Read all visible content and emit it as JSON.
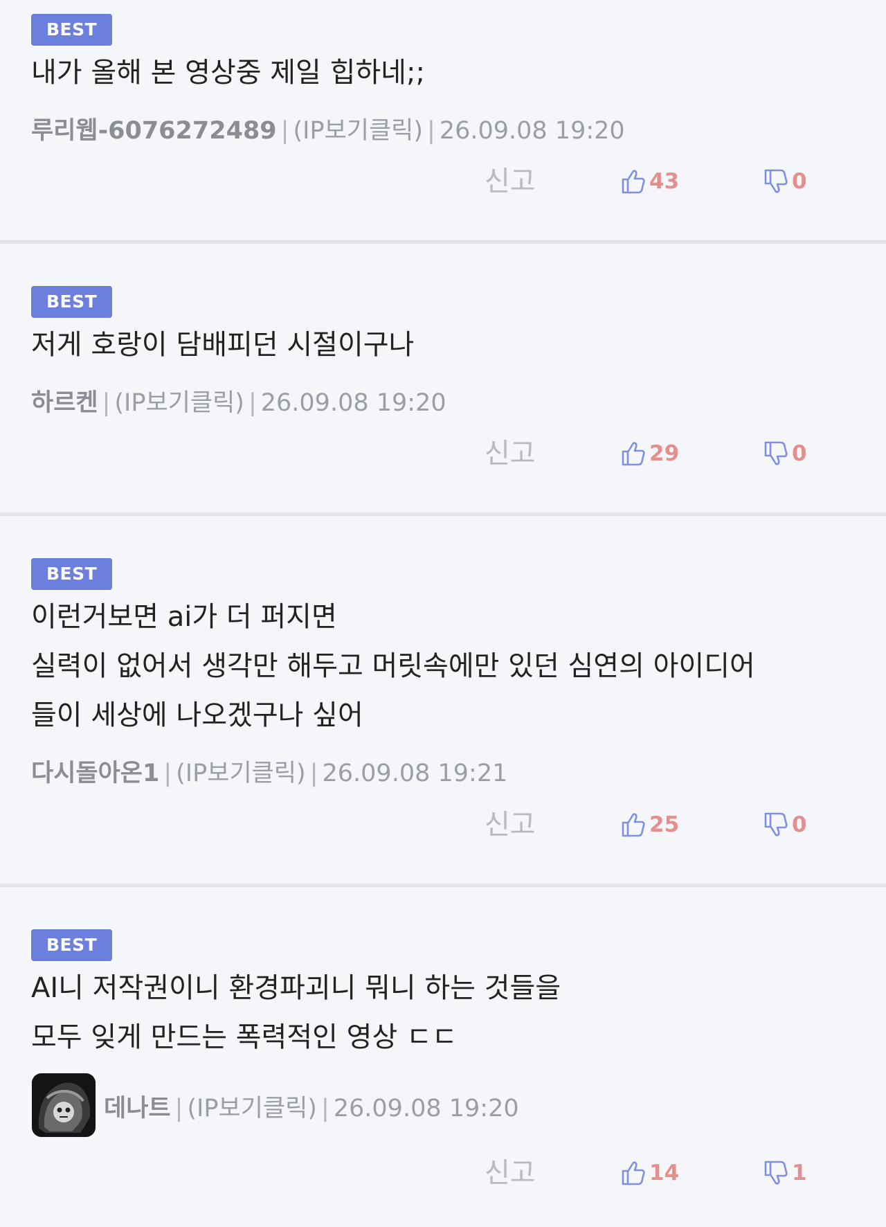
{
  "comments": [
    {
      "badge": "BEST",
      "lines": [
        "내가 올해 본 영상중 제일 힙하네;;"
      ],
      "nickname": "루리웹-6076272489",
      "ip": "(IP보기클릭)",
      "datetime": "26.09.08 19:20",
      "report": "신고",
      "likes": "43",
      "dislikes": "0"
    },
    {
      "badge": "BEST",
      "lines": [
        "저게 호랑이 담배피던 시절이구나"
      ],
      "nickname": "하르켄",
      "ip": "(IP보기클릭)",
      "datetime": "26.09.08 19:20",
      "report": "신고",
      "likes": "29",
      "dislikes": "0"
    },
    {
      "badge": "BEST",
      "lines": [
        "이런거보면 ai가 더 퍼지면",
        "실력이 없어서 생각만 해두고 머릿속에만 있던 심연의 아이디어",
        "들이 세상에 나오겠구나 싶어"
      ],
      "nickname": "다시돌아온1",
      "ip": "(IP보기클릭)",
      "datetime": "26.09.08 19:21",
      "report": "신고",
      "likes": "25",
      "dislikes": "0"
    },
    {
      "badge": "BEST",
      "lines": [
        "AI니 저작권이니 환경파괴니 뭐니 하는 것들을",
        "모두 잊게 만드는 폭력적인 영상 ㄷㄷ"
      ],
      "nickname": "데나트",
      "ip": "(IP보기클릭)",
      "datetime": "26.09.08 19:20",
      "report": "신고",
      "likes": "14",
      "dislikes": "1"
    }
  ],
  "colors": {
    "badge": "#6d7fdc",
    "background": "#f5f6fa",
    "count": "#e48e8e",
    "thumb": "#7e8fe3"
  }
}
